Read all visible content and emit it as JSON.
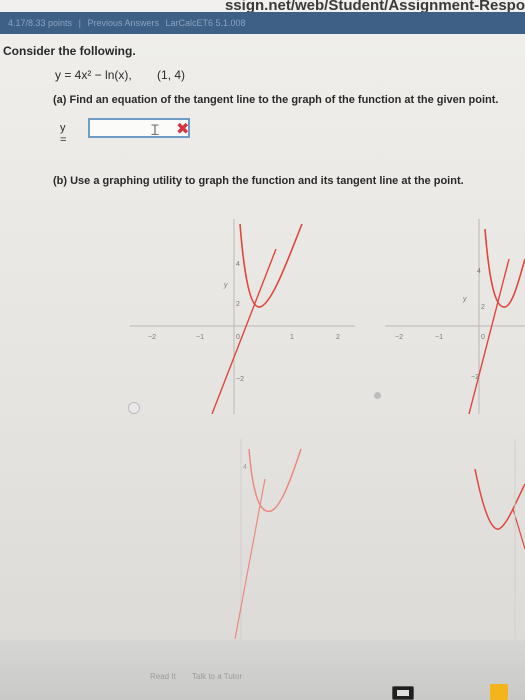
{
  "browser": {
    "url": "ssign.net/web/Student/Assignment-Respo"
  },
  "score_bar": {
    "score": "4.17/8.33 points",
    "separator": "|",
    "previous_answers": "Previous Answers",
    "problem_id": "LarCalcET6 5.1.008"
  },
  "question": {
    "prompt": "Consider the following.",
    "function": "y = 4x² − ln(x),",
    "point": "(1, 4)",
    "part_a": "(a) Find an equation of the tangent line to the graph of the function at the given point.",
    "answer_label": "y =",
    "answer_value": "",
    "part_b": "(b) Use a graphing utility to graph the function and its tangent line at the point."
  },
  "graphs": [
    {
      "y_label": "y",
      "y_ticks": [
        "4",
        "2",
        "−2"
      ],
      "x_ticks": [
        "−2",
        "−1",
        "0",
        "1",
        "2"
      ]
    },
    {
      "y_label": "y",
      "y_ticks": [
        "4",
        "2",
        "−2"
      ],
      "x_ticks": [
        "−2",
        "−1",
        "0"
      ]
    },
    {
      "y_ticks": [
        "4"
      ]
    }
  ],
  "footer": {
    "links": [
      "Read It",
      "Talk to a Tutor"
    ]
  },
  "colors": {
    "header_blue": "#3e5f86",
    "input_border": "#6f9cc6",
    "wrong_mark": "#d9323c",
    "curve_red": "#e0463c"
  }
}
